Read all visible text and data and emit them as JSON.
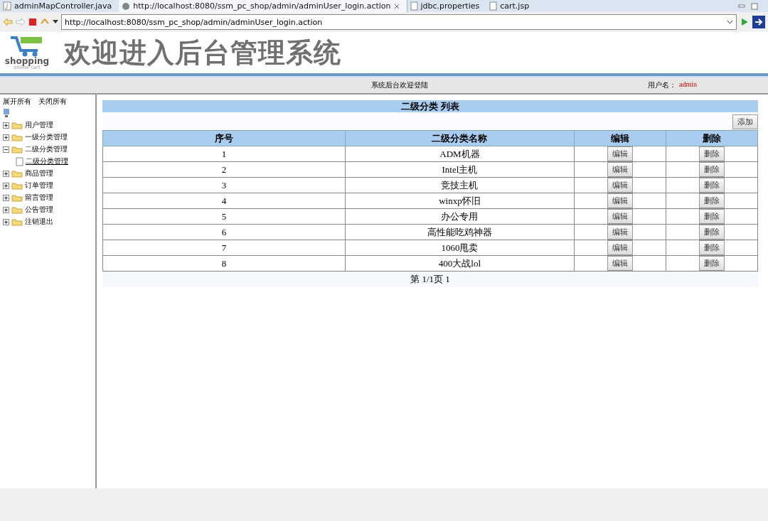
{
  "editor_tabs": [
    {
      "label": "adminMapController.java",
      "kind": "java",
      "selected": false
    },
    {
      "label": "http://localhost:8080/ssm_pc_shop/admin/adminUser_login.action",
      "kind": "web",
      "selected": true
    },
    {
      "label": "jdbc.properties",
      "kind": "file",
      "selected": false
    },
    {
      "label": "cart.jsp",
      "kind": "file",
      "selected": false
    }
  ],
  "browser": {
    "url": "http://localhost:8080/ssm_pc_shop/admin/adminUser_login.action"
  },
  "header": {
    "logo_text": "shopping",
    "logo_subtext": "online cart",
    "title": "欢迎进入后台管理系统"
  },
  "info_bar": {
    "welcome": "系统后台欢迎登陆",
    "user_label": "用户名：",
    "user_name": "admin"
  },
  "sidebar": {
    "expand_all": "展开所有",
    "collapse_all": "关闭所有",
    "tree": [
      {
        "label": "用户管理",
        "expanded": false
      },
      {
        "label": "一级分类管理",
        "expanded": false
      },
      {
        "label": "二级分类管理",
        "expanded": true,
        "children": [
          {
            "label": "二级分类管理"
          }
        ]
      },
      {
        "label": "商品管理",
        "expanded": false
      },
      {
        "label": "订单管理",
        "expanded": false
      },
      {
        "label": "留言管理",
        "expanded": false
      },
      {
        "label": "公告管理",
        "expanded": false
      },
      {
        "label": "注销退出",
        "expanded": false
      }
    ]
  },
  "main": {
    "title": "二级分类 列表",
    "add_button": "添加",
    "table": {
      "columns": [
        "序号",
        "二级分类名称",
        "编辑",
        "删除"
      ],
      "rows": [
        {
          "index": "1",
          "name": "ADM机器",
          "edit": "编辑",
          "delete": "删除"
        },
        {
          "index": "2",
          "name": "Intel主机",
          "edit": "编辑",
          "delete": "删除"
        },
        {
          "index": "3",
          "name": "竞技主机",
          "edit": "编辑",
          "delete": "删除"
        },
        {
          "index": "4",
          "name": "winxp怀旧",
          "edit": "编辑",
          "delete": "删除"
        },
        {
          "index": "5",
          "name": "办公专用",
          "edit": "编辑",
          "delete": "删除"
        },
        {
          "index": "6",
          "name": "高性能吃鸡神器",
          "edit": "编辑",
          "delete": "删除"
        },
        {
          "index": "7",
          "name": "1060甩卖",
          "edit": "编辑",
          "delete": "删除"
        },
        {
          "index": "8",
          "name": "400大战lol",
          "edit": "编辑",
          "delete": "删除"
        }
      ]
    },
    "pagination": "第 1/1页 1"
  }
}
